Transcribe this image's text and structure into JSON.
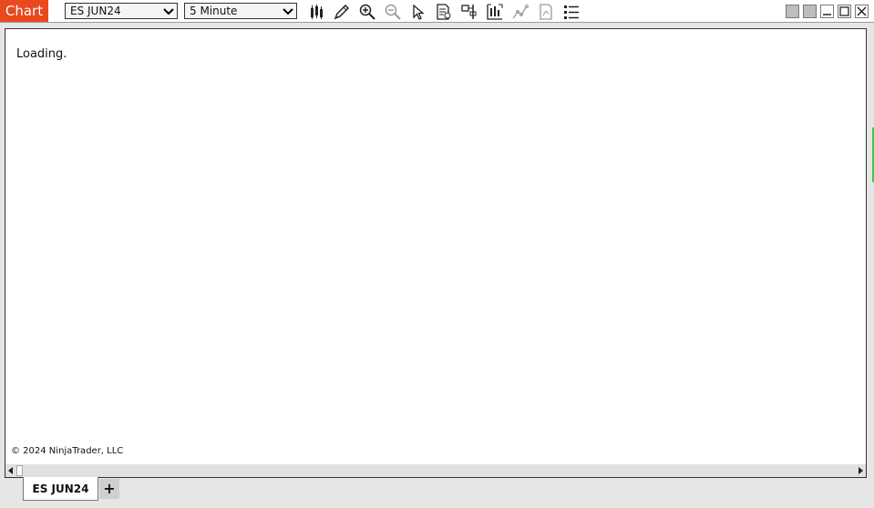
{
  "window": {
    "title_tag": "Chart",
    "instrument": "ES JUN24",
    "interval": "5 Minute"
  },
  "toolbar": {
    "icons": [
      "bar-type-icon",
      "drawing-tool-icon",
      "zoom-in-icon",
      "zoom-out-icon",
      "pointer-icon",
      "data-box-icon",
      "properties-icon",
      "indicators-icon",
      "strategies-icon",
      "chart-trader-icon",
      "list-icon"
    ],
    "window_buttons": [
      "link-instrument-icon",
      "link-interval-icon",
      "minimize-icon",
      "maximize-icon",
      "close-icon"
    ]
  },
  "chart": {
    "status": "Loading.",
    "copyright": "© 2024 NinjaTrader, LLC"
  },
  "tabs": [
    {
      "label": "ES JUN24"
    }
  ],
  "add_tab_label": "+",
  "colors": {
    "brand": "#e8491d",
    "window_bg": "#e6e6e6"
  }
}
